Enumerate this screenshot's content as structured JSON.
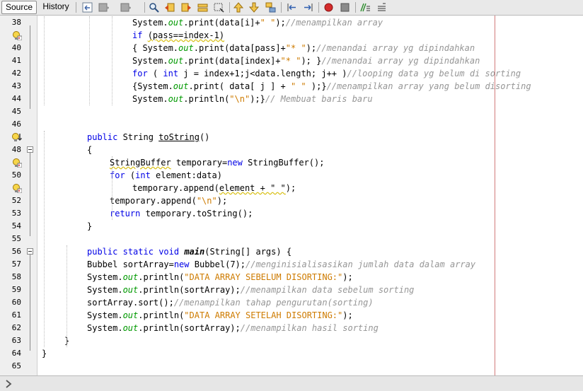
{
  "toolbar": {
    "tabs": [
      {
        "label": "Source",
        "active": true
      },
      {
        "label": "History",
        "active": false
      }
    ],
    "icons": [
      "back-to-last-edit-icon",
      "navigate-back-icon",
      "navigate-forward-icon",
      "find-selection-icon",
      "find-previous-icon",
      "find-next-icon",
      "toggle-highlight-icon",
      "toggle-rect-select-icon",
      "previous-bookmark-icon",
      "next-bookmark-icon",
      "toggle-bookmark-icon",
      "shift-left-icon",
      "shift-right-icon",
      "start-macro-icon",
      "stop-macro-icon",
      "comment-icon",
      "uncomment-icon"
    ]
  },
  "editor": {
    "lines": [
      {
        "n": "38",
        "indent": 4,
        "tokens": [
          [
            "p",
            "System."
          ],
          [
            "fld",
            "out"
          ],
          [
            "p",
            ".print(data[i]+"
          ],
          [
            "str",
            "\" \""
          ],
          [
            "p",
            ");"
          ],
          [
            "cm",
            "//menampilkan array"
          ]
        ]
      },
      {
        "n": "",
        "hint": "warning-bulb-icon",
        "indent": 4,
        "tokens": [
          [
            "kw",
            "if"
          ],
          [
            "p",
            " "
          ],
          [
            "wavy",
            "(pass==index-1)"
          ]
        ]
      },
      {
        "n": "40",
        "indent": 4,
        "tokens": [
          [
            "p",
            "{ System."
          ],
          [
            "fld",
            "out"
          ],
          [
            "p",
            ".print(data[pass]+"
          ],
          [
            "str",
            "\"* \""
          ],
          [
            "p",
            ");"
          ],
          [
            "cm",
            "//menandai array yg dipindahkan"
          ]
        ]
      },
      {
        "n": "41",
        "indent": 4,
        "tokens": [
          [
            "p",
            "System."
          ],
          [
            "fld",
            "out"
          ],
          [
            "p",
            ".print(data[index]+"
          ],
          [
            "str",
            "\"* \""
          ],
          [
            "p",
            "); }"
          ],
          [
            "cm",
            "//menandai array yg dipindahkan"
          ]
        ]
      },
      {
        "n": "42",
        "indent": 4,
        "tokens": [
          [
            "kw",
            "for"
          ],
          [
            "p",
            " ( "
          ],
          [
            "kw",
            "int"
          ],
          [
            "p",
            " j = index+1;j<data.length; j++ )"
          ],
          [
            "cm",
            "//looping data yg belum di sorting"
          ]
        ]
      },
      {
        "n": "43",
        "indent": 4,
        "tokens": [
          [
            "p",
            "{System."
          ],
          [
            "fld",
            "out"
          ],
          [
            "p",
            ".print( data[ j ] + "
          ],
          [
            "str",
            "\" \""
          ],
          [
            "p",
            " );}"
          ],
          [
            "cm",
            "//menampilkan array yang belum disorting"
          ]
        ]
      },
      {
        "n": "44",
        "indent": 4,
        "tokens": [
          [
            "p",
            "System."
          ],
          [
            "fld",
            "out"
          ],
          [
            "p",
            ".println("
          ],
          [
            "str",
            "\"\\n\""
          ],
          [
            "p",
            ");}"
          ],
          [
            "cm",
            "// Membuat baris baru"
          ]
        ]
      },
      {
        "n": "45",
        "indent": 0,
        "tokens": []
      },
      {
        "n": "46",
        "indent": 0,
        "tokens": []
      },
      {
        "n": "",
        "hint": "override-warning-icon",
        "indent": 2,
        "tokens": [
          [
            "kw",
            "public"
          ],
          [
            "p",
            " String "
          ],
          [
            "und",
            "toString"
          ],
          [
            "p",
            "()"
          ]
        ]
      },
      {
        "n": "48",
        "fold": true,
        "indent": 2,
        "tokens": [
          [
            "p",
            "{"
          ]
        ]
      },
      {
        "n": "",
        "hint": "warning-bulb-icon",
        "indent": 3,
        "tokens": [
          [
            "wavy",
            "StringBuffer"
          ],
          [
            "p",
            " temporary="
          ],
          [
            "kw",
            "new"
          ],
          [
            "p",
            " StringBuffer();"
          ]
        ]
      },
      {
        "n": "50",
        "indent": 3,
        "tokens": [
          [
            "kw",
            "for"
          ],
          [
            "p",
            " ("
          ],
          [
            "kw",
            "int"
          ],
          [
            "p",
            " element:data)"
          ]
        ]
      },
      {
        "n": "",
        "hint": "warning-bulb-icon",
        "indent": 4,
        "tokens": [
          [
            "p",
            "temporary.append("
          ],
          [
            "wavy",
            "element + \" \""
          ],
          [
            "p",
            ");"
          ]
        ]
      },
      {
        "n": "52",
        "indent": 3,
        "tokens": [
          [
            "p",
            "temporary.append("
          ],
          [
            "str",
            "\"\\n\""
          ],
          [
            "p",
            ");"
          ]
        ]
      },
      {
        "n": "53",
        "indent": 3,
        "tokens": [
          [
            "kw",
            "return"
          ],
          [
            "p",
            " temporary.toString();"
          ]
        ]
      },
      {
        "n": "54",
        "indent": 2,
        "tokens": [
          [
            "p",
            "}"
          ]
        ]
      },
      {
        "n": "55",
        "indent": 0,
        "tokens": []
      },
      {
        "n": "56",
        "fold": true,
        "indent": 2,
        "tokens": [
          [
            "kw",
            "public"
          ],
          [
            "p",
            " "
          ],
          [
            "kw",
            "static"
          ],
          [
            "p",
            " "
          ],
          [
            "kw",
            "void"
          ],
          [
            "p",
            " "
          ],
          [
            "fnbi",
            "main"
          ],
          [
            "p",
            "(String[] args) {"
          ]
        ]
      },
      {
        "n": "57",
        "indent": 2,
        "tokens": [
          [
            "p",
            "Bubbel sortArray="
          ],
          [
            "kw",
            "new"
          ],
          [
            "p",
            " Bubbel(7);"
          ],
          [
            "cm",
            "//menginisialisasikan jumlah data dalam array"
          ]
        ]
      },
      {
        "n": "58",
        "indent": 2,
        "tokens": [
          [
            "p",
            "System."
          ],
          [
            "fld",
            "out"
          ],
          [
            "p",
            ".println("
          ],
          [
            "str",
            "\"DATA ARRAY SEBELUM DISORTING:\""
          ],
          [
            "p",
            ");"
          ]
        ]
      },
      {
        "n": "59",
        "indent": 2,
        "tokens": [
          [
            "p",
            "System."
          ],
          [
            "fld",
            "out"
          ],
          [
            "p",
            ".println(sortArray);"
          ],
          [
            "cm",
            "//menampilkan data sebelum sorting"
          ]
        ]
      },
      {
        "n": "60",
        "indent": 2,
        "tokens": [
          [
            "p",
            "sortArray.sort();"
          ],
          [
            "cm",
            "//menampilkan tahap pengurutan(sorting)"
          ]
        ]
      },
      {
        "n": "61",
        "indent": 2,
        "tokens": [
          [
            "p",
            "System."
          ],
          [
            "fld",
            "out"
          ],
          [
            "p",
            ".println("
          ],
          [
            "str",
            "\"DATA ARRAY SETELAH DISORTING:\""
          ],
          [
            "p",
            ");"
          ]
        ]
      },
      {
        "n": "62",
        "indent": 2,
        "tokens": [
          [
            "p",
            "System."
          ],
          [
            "fld",
            "out"
          ],
          [
            "p",
            ".println(sortArray);"
          ],
          [
            "cm",
            "//menampilkan hasil sorting"
          ]
        ]
      },
      {
        "n": "63",
        "indent": 1,
        "tokens": [
          [
            "p",
            "}"
          ]
        ]
      },
      {
        "n": "64",
        "indent": 0,
        "tokens": [
          [
            "p",
            "}"
          ]
        ]
      },
      {
        "n": "65",
        "indent": 0,
        "tokens": []
      }
    ]
  },
  "bottombar": {
    "icon": "expand-arrow-icon"
  },
  "colors": {
    "keyword": "#0000e6",
    "string": "#ce7b00",
    "comment": "#969696",
    "field": "#009900",
    "margin_line": "#d27b7b"
  }
}
